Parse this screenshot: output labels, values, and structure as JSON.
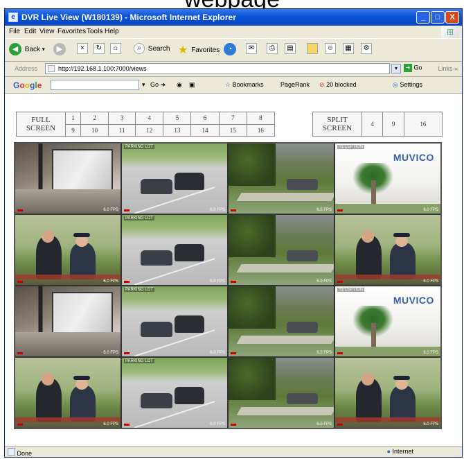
{
  "top_text": "webpage",
  "window": {
    "title": "DVR Live View (W180139) - Microsoft Internet Explorer",
    "controls": [
      "_",
      "□",
      "X"
    ]
  },
  "menu": [
    "File",
    "Edit",
    "View",
    "Favorites",
    "Tools",
    "Help"
  ],
  "toolbar": {
    "back": "Back",
    "search": "Search",
    "favorites": "Favorites"
  },
  "address": {
    "label": "Address",
    "url": "http://192.168.1.100:7000/views",
    "go": "Go",
    "links": "Links »"
  },
  "googlebar": {
    "label": "Google",
    "go": "Go",
    "bookmarks": "Bookmarks",
    "pagerank": "PageRank",
    "blocked": "20 blocked",
    "settings": "Settings"
  },
  "full_screen": {
    "label_1": "FULL",
    "label_2": "SCREEN",
    "row1": [
      "1",
      "2",
      "3",
      "4",
      "5",
      "6",
      "7",
      "8"
    ],
    "row2": [
      "9",
      "10",
      "11",
      "12",
      "13",
      "14",
      "15",
      "16"
    ]
  },
  "split_screen": {
    "label_1": "SPLIT",
    "label_2": "SCREEN",
    "options": [
      "4",
      "9",
      "16"
    ]
  },
  "cameras": [
    {
      "scene": "door",
      "osd": "",
      "fps": "6.0 FPS"
    },
    {
      "scene": "lot",
      "osd": "PARKING LOT",
      "fps": "6.0 FPS"
    },
    {
      "scene": "yard",
      "osd": "",
      "fps": "6.0 FPS"
    },
    {
      "scene": "palm",
      "osd": "RECEPTION",
      "fps": "6.0 FPS"
    },
    {
      "scene": "people",
      "osd": "",
      "fps": "6.0 FPS"
    },
    {
      "scene": "lot",
      "osd": "PARKING LOT",
      "fps": "6.0 FPS"
    },
    {
      "scene": "yard",
      "osd": "",
      "fps": "6.0 FPS"
    },
    {
      "scene": "people",
      "osd": "",
      "fps": "6.0 FPS"
    },
    {
      "scene": "door",
      "osd": "",
      "fps": "6.0 FPS"
    },
    {
      "scene": "lot",
      "osd": "PARKING LOT",
      "fps": "6.0 FPS"
    },
    {
      "scene": "yard",
      "osd": "",
      "fps": "6.0 FPS"
    },
    {
      "scene": "palm",
      "osd": "RECEPTION",
      "fps": "6.0 FPS"
    },
    {
      "scene": "people",
      "osd": "",
      "fps": "6.0 FPS"
    },
    {
      "scene": "lot",
      "osd": "PARKING LOT",
      "fps": "6.0 FPS"
    },
    {
      "scene": "yard",
      "osd": "",
      "fps": "6.0 FPS"
    },
    {
      "scene": "people",
      "osd": "",
      "fps": "6.0 FPS"
    }
  ],
  "status": {
    "left": "Done",
    "right": "Internet"
  }
}
